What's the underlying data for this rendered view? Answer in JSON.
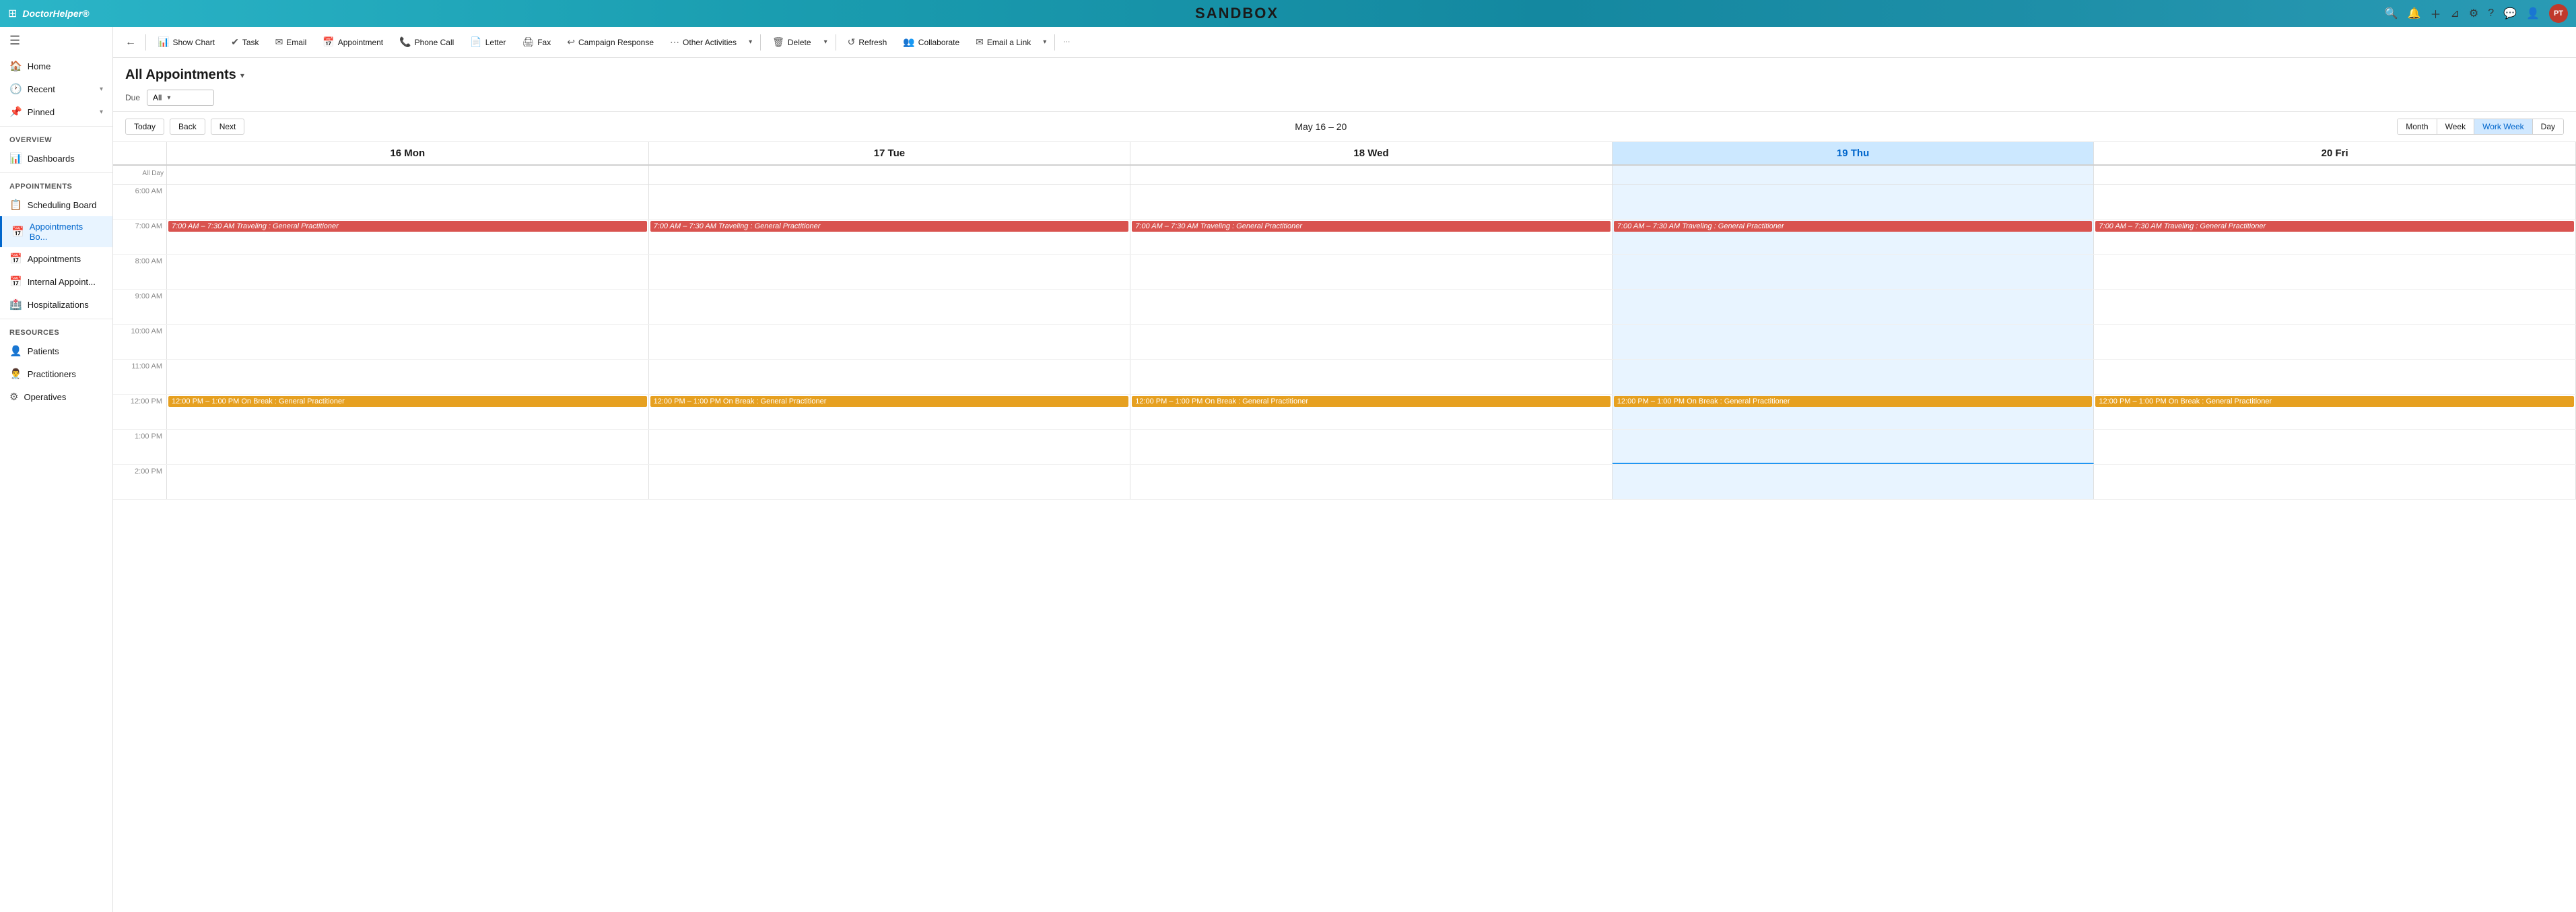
{
  "appBar": {
    "logoText": "DoctorHelper®",
    "appName": "DoctorHelper®",
    "title": "SANDBOX",
    "avatarText": "PT"
  },
  "toolbar": {
    "backLabel": "←",
    "buttons": [
      {
        "id": "show-chart",
        "icon": "📊",
        "label": "Show Chart"
      },
      {
        "id": "task",
        "icon": "✔",
        "label": "Task"
      },
      {
        "id": "email",
        "icon": "✉",
        "label": "Email"
      },
      {
        "id": "appointment",
        "icon": "📅",
        "label": "Appointment"
      },
      {
        "id": "phone-call",
        "icon": "📞",
        "label": "Phone Call"
      },
      {
        "id": "letter",
        "icon": "📄",
        "label": "Letter"
      },
      {
        "id": "fax",
        "icon": "🖨",
        "label": "Fax"
      },
      {
        "id": "campaign-response",
        "icon": "↩",
        "label": "Campaign Response"
      },
      {
        "id": "other-activities",
        "icon": "⋯",
        "label": "Other Activities"
      },
      {
        "id": "delete",
        "icon": "🗑",
        "label": "Delete"
      },
      {
        "id": "refresh",
        "icon": "↺",
        "label": "Refresh"
      },
      {
        "id": "collaborate",
        "icon": "👥",
        "label": "Collaborate"
      },
      {
        "id": "email-link",
        "icon": "✉",
        "label": "Email a Link"
      }
    ]
  },
  "pageHeader": {
    "title": "All Appointments",
    "filterLabel": "Due",
    "filterValue": "All"
  },
  "calendar": {
    "navButtons": [
      "Today",
      "Back",
      "Next"
    ],
    "rangeTitle": "May 16 – 20",
    "viewButtons": [
      "Month",
      "Week",
      "Work Week",
      "Day"
    ],
    "activeView": "Work Week",
    "days": [
      {
        "label": "16 Mon",
        "isToday": false
      },
      {
        "label": "17 Tue",
        "isToday": false
      },
      {
        "label": "18 Wed",
        "isToday": false
      },
      {
        "label": "19 Thu",
        "isToday": true
      },
      {
        "label": "20 Fri",
        "isToday": false
      }
    ],
    "allDayLabel": "All Day",
    "timeSlots": [
      {
        "time": "6:00 AM"
      },
      {
        "time": "7:00 AM"
      },
      {
        "time": "8:00 AM"
      },
      {
        "time": "9:00 AM"
      },
      {
        "time": "10:00 AM"
      },
      {
        "time": "11:00 AM"
      },
      {
        "time": "12:00 PM"
      },
      {
        "time": "1:00 PM"
      },
      {
        "time": "2:00 PM"
      }
    ],
    "events": {
      "traveling": {
        "label": "7:00 AM – 7:30 AM  Traveling : General Practitioner",
        "type": "red",
        "timeSlot": "7:00 AM"
      },
      "onBreak": {
        "label": "12:00 PM – 1:00 PM  On Break : General Practitioner",
        "type": "orange",
        "timeSlot": "12:00 PM"
      }
    }
  },
  "sidebar": {
    "hamburger": "☰",
    "items": [
      {
        "id": "home",
        "icon": "🏠",
        "label": "Home",
        "hasChevron": false
      },
      {
        "id": "recent",
        "icon": "🕐",
        "label": "Recent",
        "hasChevron": true
      },
      {
        "id": "pinned",
        "icon": "📌",
        "label": "Pinned",
        "hasChevron": true
      }
    ],
    "sections": [
      {
        "header": "Overview",
        "items": [
          {
            "id": "dashboards",
            "icon": "📊",
            "label": "Dashboards"
          }
        ]
      },
      {
        "header": "Appointments",
        "items": [
          {
            "id": "scheduling-board",
            "icon": "📋",
            "label": "Scheduling Board"
          },
          {
            "id": "appointments-bo",
            "icon": "📅",
            "label": "Appointments Bo...",
            "active": true
          },
          {
            "id": "appointments",
            "icon": "📅",
            "label": "Appointments"
          },
          {
            "id": "internal-appoint",
            "icon": "📅",
            "label": "Internal Appoint..."
          },
          {
            "id": "hospitalizations",
            "icon": "🏥",
            "label": "Hospitalizations"
          }
        ]
      },
      {
        "header": "Resources",
        "items": [
          {
            "id": "patients",
            "icon": "👤",
            "label": "Patients"
          },
          {
            "id": "practitioners",
            "icon": "👨‍⚕️",
            "label": "Practitioners"
          },
          {
            "id": "operatives",
            "icon": "⚙",
            "label": "Operatives"
          }
        ]
      }
    ]
  }
}
